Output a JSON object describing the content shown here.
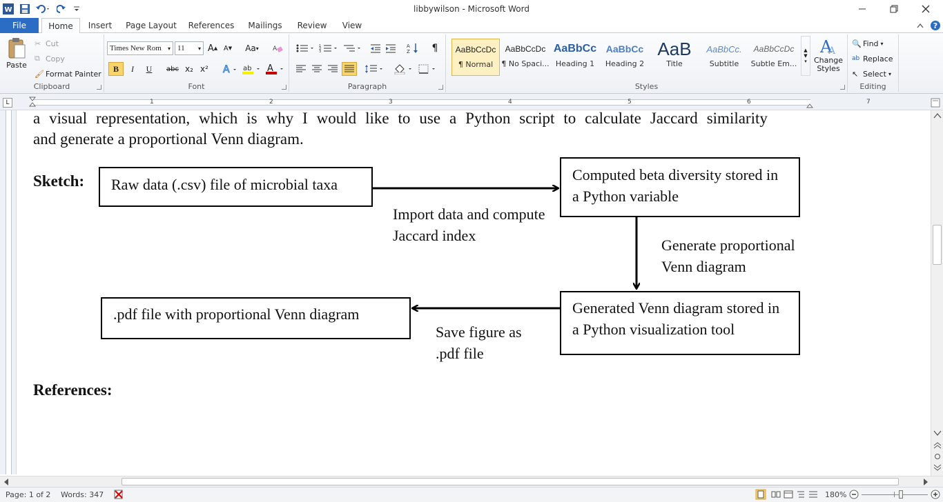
{
  "window": {
    "title": "libbywilson  -  Microsoft Word"
  },
  "tabs": [
    "File",
    "Home",
    "Insert",
    "Page Layout",
    "References",
    "Mailings",
    "Review",
    "View"
  ],
  "clipboard": {
    "paste": "Paste",
    "cut": "Cut",
    "copy": "Copy",
    "format_painter": "Format Painter",
    "label": "Clipboard"
  },
  "font": {
    "family": "Times New Rom",
    "size": "11",
    "grow": "A",
    "shrink": "A",
    "change_case": "Aa",
    "bold": "B",
    "italic": "I",
    "underline": "U",
    "strike": "abc",
    "subscript": "x₂",
    "superscript": "x²",
    "label": "Font"
  },
  "paragraph": {
    "pilcrow": "¶",
    "label": "Paragraph"
  },
  "styles": {
    "items": [
      {
        "preview": "AaBbCcDc",
        "name": "¶ Normal"
      },
      {
        "preview": "AaBbCcDc",
        "name": "¶ No Spaci..."
      },
      {
        "preview": "AaBbCc",
        "name": "Heading 1"
      },
      {
        "preview": "AaBbCc",
        "name": "Heading 2"
      },
      {
        "preview": "AaB",
        "name": "Title"
      },
      {
        "preview": "AaBbCc.",
        "name": "Subtitle"
      },
      {
        "preview": "AaBbCcDc",
        "name": "Subtle Em..."
      }
    ],
    "change_styles": "Change Styles",
    "label": "Styles"
  },
  "editing": {
    "find": "Find",
    "replace": "Replace",
    "select": "Select",
    "label": "Editing"
  },
  "ruler": {
    "numbers": [
      "1",
      "2",
      "3",
      "4",
      "5",
      "6",
      "7"
    ]
  },
  "document": {
    "line1": "a visual representation, which is why I would like to use a Python script to calculate Jaccard similarity",
    "line2": "and generate a proportional Venn diagram.",
    "sketch_label": "Sketch:",
    "box_raw": "Raw data (.csv) file of microbial taxa",
    "box_beta": "Computed beta diversity stored in a Python variable",
    "box_venn": "Generated Venn diagram stored in a Python visualization tool",
    "box_pdf": ".pdf file with proportional Venn diagram",
    "arrow_import": "Import data and compute Jaccard index",
    "arrow_generate": "Generate proportional Venn diagram",
    "arrow_save": "Save figure as .pdf file",
    "references": "References:"
  },
  "status": {
    "page": "Page: 1 of 2",
    "words": "Words: 347",
    "zoom": "180%"
  }
}
